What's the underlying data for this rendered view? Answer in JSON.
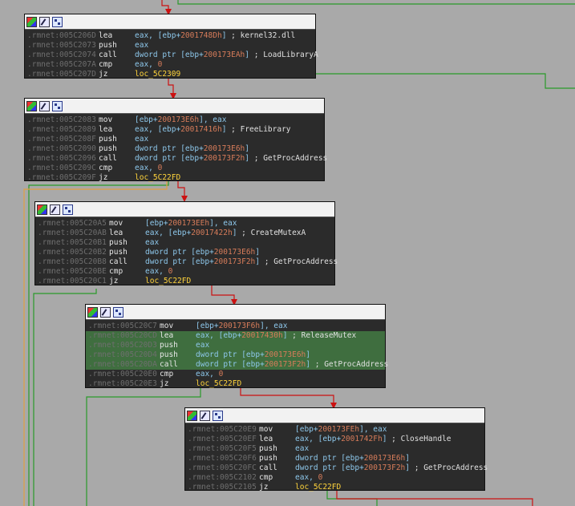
{
  "blocks": [
    {
      "id": "b1",
      "lines": [
        {
          "addr": ".rmnet:005C206D",
          "mnem": "lea",
          "ops": [
            {
              "t": "eax, [ebp+",
              "c": "reg"
            },
            {
              "t": "2001748Dh",
              "c": "num"
            },
            {
              "t": "]",
              "c": "reg"
            }
          ],
          "comment": "; kernel32.dll"
        },
        {
          "addr": ".rmnet:005C2073",
          "mnem": "push",
          "ops": [
            {
              "t": "eax",
              "c": "reg"
            }
          ],
          "comment": ""
        },
        {
          "addr": ".rmnet:005C2074",
          "mnem": "call",
          "ops": [
            {
              "t": "dword ptr [ebp+",
              "c": "reg"
            },
            {
              "t": "200173EAh",
              "c": "num"
            },
            {
              "t": "]",
              "c": "reg"
            }
          ],
          "comment": "; LoadLibraryA"
        },
        {
          "addr": ".rmnet:005C207A",
          "mnem": "cmp",
          "ops": [
            {
              "t": "eax, ",
              "c": "reg"
            },
            {
              "t": "0",
              "c": "num"
            }
          ],
          "comment": ""
        },
        {
          "addr": ".rmnet:005C207D",
          "mnem": "jz",
          "ops": [
            {
              "t": "loc_5C2309",
              "c": "lbl"
            }
          ],
          "comment": ""
        }
      ]
    },
    {
      "id": "b2",
      "lines": [
        {
          "addr": ".rmnet:005C2083",
          "mnem": "mov",
          "ops": [
            {
              "t": "[ebp+",
              "c": "reg"
            },
            {
              "t": "200173E6h",
              "c": "num"
            },
            {
              "t": "], eax",
              "c": "reg"
            }
          ],
          "comment": ""
        },
        {
          "addr": ".rmnet:005C2089",
          "mnem": "lea",
          "ops": [
            {
              "t": "eax, [ebp+",
              "c": "reg"
            },
            {
              "t": "20017416h",
              "c": "num"
            },
            {
              "t": "]",
              "c": "reg"
            }
          ],
          "comment": "; FreeLibrary"
        },
        {
          "addr": ".rmnet:005C208F",
          "mnem": "push",
          "ops": [
            {
              "t": "eax",
              "c": "reg"
            }
          ],
          "comment": ""
        },
        {
          "addr": ".rmnet:005C2090",
          "mnem": "push",
          "ops": [
            {
              "t": "dword ptr [ebp+",
              "c": "reg"
            },
            {
              "t": "200173E6h",
              "c": "num"
            },
            {
              "t": "]",
              "c": "reg"
            }
          ],
          "comment": ""
        },
        {
          "addr": ".rmnet:005C2096",
          "mnem": "call",
          "ops": [
            {
              "t": "dword ptr [ebp+",
              "c": "reg"
            },
            {
              "t": "200173F2h",
              "c": "num"
            },
            {
              "t": "]",
              "c": "reg"
            }
          ],
          "comment": "; GetProcAddress"
        },
        {
          "addr": ".rmnet:005C209C",
          "mnem": "cmp",
          "ops": [
            {
              "t": "eax, ",
              "c": "reg"
            },
            {
              "t": "0",
              "c": "num"
            }
          ],
          "comment": ""
        },
        {
          "addr": ".rmnet:005C209F",
          "mnem": "jz",
          "ops": [
            {
              "t": "loc_5C22FD",
              "c": "lbl"
            }
          ],
          "comment": ""
        }
      ]
    },
    {
      "id": "b3",
      "lines": [
        {
          "addr": ".rmnet:005C20A5",
          "mnem": "mov",
          "ops": [
            {
              "t": "[ebp+",
              "c": "reg"
            },
            {
              "t": "200173EEh",
              "c": "num"
            },
            {
              "t": "], eax",
              "c": "reg"
            }
          ],
          "comment": ""
        },
        {
          "addr": ".rmnet:005C20AB",
          "mnem": "lea",
          "ops": [
            {
              "t": "eax, [ebp+",
              "c": "reg"
            },
            {
              "t": "20017422h",
              "c": "num"
            },
            {
              "t": "]",
              "c": "reg"
            }
          ],
          "comment": "; CreateMutexA"
        },
        {
          "addr": ".rmnet:005C20B1",
          "mnem": "push",
          "ops": [
            {
              "t": "eax",
              "c": "reg"
            }
          ],
          "comment": ""
        },
        {
          "addr": ".rmnet:005C20B2",
          "mnem": "push",
          "ops": [
            {
              "t": "dword ptr [ebp+",
              "c": "reg"
            },
            {
              "t": "200173E6h",
              "c": "num"
            },
            {
              "t": "]",
              "c": "reg"
            }
          ],
          "comment": ""
        },
        {
          "addr": ".rmnet:005C20B8",
          "mnem": "call",
          "ops": [
            {
              "t": "dword ptr [ebp+",
              "c": "reg"
            },
            {
              "t": "200173F2h",
              "c": "num"
            },
            {
              "t": "]",
              "c": "reg"
            }
          ],
          "comment": "; GetProcAddress"
        },
        {
          "addr": ".rmnet:005C20BE",
          "mnem": "cmp",
          "ops": [
            {
              "t": "eax, ",
              "c": "reg"
            },
            {
              "t": "0",
              "c": "num"
            }
          ],
          "comment": ""
        },
        {
          "addr": ".rmnet:005C20C1",
          "mnem": "jz",
          "ops": [
            {
              "t": "loc_5C22FD",
              "c": "lbl"
            }
          ],
          "comment": ""
        }
      ]
    },
    {
      "id": "b4",
      "lines": [
        {
          "addr": ".rmnet:005C20C7",
          "mnem": "mov",
          "ops": [
            {
              "t": "[ebp+",
              "c": "reg"
            },
            {
              "t": "200173F6h",
              "c": "num"
            },
            {
              "t": "], eax",
              "c": "reg"
            }
          ],
          "comment": ""
        },
        {
          "addr": ".rmnet:005C20CD",
          "mnem": "lea",
          "ops": [
            {
              "t": "eax, [ebp+",
              "c": "reg"
            },
            {
              "t": "20017430h",
              "c": "num"
            },
            {
              "t": "]",
              "c": "reg"
            }
          ],
          "comment": "; ReleaseMutex",
          "hl": true
        },
        {
          "addr": ".rmnet:005C20D3",
          "mnem": "push",
          "ops": [
            {
              "t": "eax",
              "c": "reg"
            }
          ],
          "comment": "",
          "hl": true
        },
        {
          "addr": ".rmnet:005C20D4",
          "mnem": "push",
          "ops": [
            {
              "t": "dword ptr [ebp+",
              "c": "reg"
            },
            {
              "t": "200173E6h",
              "c": "num"
            },
            {
              "t": "]",
              "c": "reg"
            }
          ],
          "comment": "",
          "hl": true
        },
        {
          "addr": ".rmnet:005C20DA",
          "mnem": "call",
          "ops": [
            {
              "t": "dword ptr [ebp+",
              "c": "reg"
            },
            {
              "t": "200173F2h",
              "c": "num"
            },
            {
              "t": "]",
              "c": "reg"
            }
          ],
          "comment": "; GetProcAddress",
          "hl": true
        },
        {
          "addr": ".rmnet:005C20E0",
          "mnem": "cmp",
          "ops": [
            {
              "t": "eax, ",
              "c": "reg"
            },
            {
              "t": "0",
              "c": "num"
            }
          ],
          "comment": ""
        },
        {
          "addr": ".rmnet:005C20E3",
          "mnem": "jz",
          "ops": [
            {
              "t": "loc_5C22FD",
              "c": "lbl"
            }
          ],
          "comment": ""
        }
      ]
    },
    {
      "id": "b5",
      "lines": [
        {
          "addr": ".rmnet:005C20E9",
          "mnem": "mov",
          "ops": [
            {
              "t": "[ebp+",
              "c": "reg"
            },
            {
              "t": "200173FEh",
              "c": "num"
            },
            {
              "t": "], eax",
              "c": "reg"
            }
          ],
          "comment": ""
        },
        {
          "addr": ".rmnet:005C20EF",
          "mnem": "lea",
          "ops": [
            {
              "t": "eax, [ebp+",
              "c": "reg"
            },
            {
              "t": "2001742Fh",
              "c": "num"
            },
            {
              "t": "]",
              "c": "reg"
            }
          ],
          "comment": "; CloseHandle"
        },
        {
          "addr": ".rmnet:005C20F5",
          "mnem": "push",
          "ops": [
            {
              "t": "eax",
              "c": "reg"
            }
          ],
          "comment": ""
        },
        {
          "addr": ".rmnet:005C20F6",
          "mnem": "push",
          "ops": [
            {
              "t": "dword ptr [ebp+",
              "c": "reg"
            },
            {
              "t": "200173E6h",
              "c": "num"
            },
            {
              "t": "]",
              "c": "reg"
            }
          ],
          "comment": ""
        },
        {
          "addr": ".rmnet:005C20FC",
          "mnem": "call",
          "ops": [
            {
              "t": "dword ptr [ebp+",
              "c": "reg"
            },
            {
              "t": "200173F2h",
              "c": "num"
            },
            {
              "t": "]",
              "c": "reg"
            }
          ],
          "comment": "; GetProcAddress"
        },
        {
          "addr": ".rmnet:005C2102",
          "mnem": "cmp",
          "ops": [
            {
              "t": "eax, ",
              "c": "reg"
            },
            {
              "t": "0",
              "c": "num"
            }
          ],
          "comment": ""
        },
        {
          "addr": ".rmnet:005C2105",
          "mnem": "jz",
          "ops": [
            {
              "t": "loc_5C22FD",
              "c": "lbl"
            }
          ],
          "comment": ""
        }
      ]
    }
  ],
  "colors": {
    "background": "#a9a9a9",
    "node_bg": "#2b2b2b",
    "address": "#6e6e6e",
    "register": "#8ec8ec",
    "number": "#d77c5a",
    "label": "#ffd43b",
    "highlight": "#3f6e3f",
    "edge_true": "#2a9a2a",
    "edge_false": "#cc1111",
    "edge_uncond": "#e0a040"
  },
  "header_icons": [
    "color-palette-icon",
    "edit-pencil-icon",
    "graph-view-icon"
  ]
}
